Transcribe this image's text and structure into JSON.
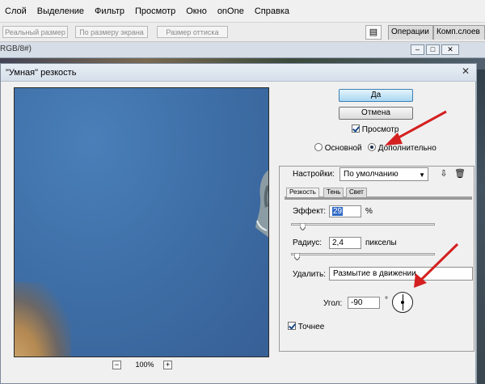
{
  "menubar": {
    "items": [
      "Слой",
      "Выделение",
      "Фильтр",
      "Просмотр",
      "Окно",
      "onOne",
      "Справка"
    ]
  },
  "optionsbar": {
    "buttons": [
      "Реальный размер",
      "По размеру экрана",
      "Размер оттиска"
    ],
    "palette_tabs": [
      "Операции",
      "Комп.слоев"
    ]
  },
  "document": {
    "title": "RGB/8#)"
  },
  "dialog": {
    "title": "\"Умная\" резкость",
    "ok_label": "Да",
    "cancel_label": "Отмена",
    "preview_label": "Просмотр",
    "preview_checked": true,
    "mode_basic_label": "Основной",
    "mode_advanced_label": "Дополнительно",
    "mode_selected": "advanced",
    "settings_label": "Настройки:",
    "settings_value": "По умолчанию",
    "tabs": [
      "Резкость",
      "Тень",
      "Свет"
    ],
    "active_tab": "Резкость",
    "amount_label": "Эффект:",
    "amount_value": "29",
    "amount_unit": "%",
    "amount_fraction": 0.06,
    "radius_label": "Радиус:",
    "radius_value": "2,4",
    "radius_unit": "пикселы",
    "radius_fraction": 0.02,
    "remove_label": "Удалить:",
    "remove_value": "Размытие в движении",
    "angle_label": "Угол:",
    "angle_value": "-90",
    "angle_unit": "°",
    "more_accurate_label": "Точнее",
    "more_accurate_checked": true,
    "zoom_value": "100%",
    "zoom_minus": "−",
    "zoom_plus": "+"
  },
  "colors": {
    "annotation_arrow": "#d42020",
    "ok_button_accent": "#3c7fb1"
  }
}
